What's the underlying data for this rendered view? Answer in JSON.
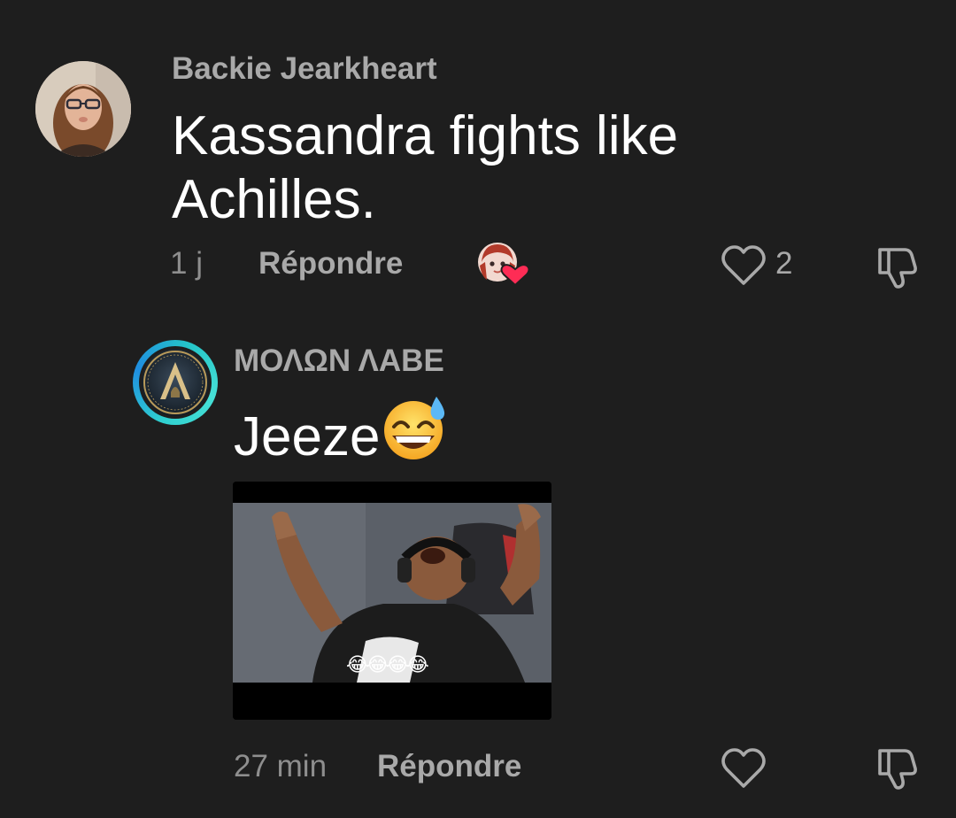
{
  "comments": [
    {
      "author": "Backie Jearkheart",
      "text": "Kassandra fights like Achilles.",
      "time": "1 j",
      "reply_label": "Répondre",
      "like_count": "2",
      "liked_by_creator": true
    },
    {
      "author": "ΜΟΛΩΝ ΛΑΒΕ",
      "text": "Jeeze",
      "emoji": "😅",
      "time": "27 min",
      "reply_label": "Répondre",
      "attachment": {
        "type": "gif",
        "overlay_emojis": "😂😂😂😂"
      }
    }
  ],
  "colors": {
    "background": "#1e1e1e",
    "primary_text": "#ffffff",
    "secondary_text": "#a9a9a9",
    "heart_badge": "#fe2c55",
    "avatar_ring": "#2fd0d0"
  }
}
